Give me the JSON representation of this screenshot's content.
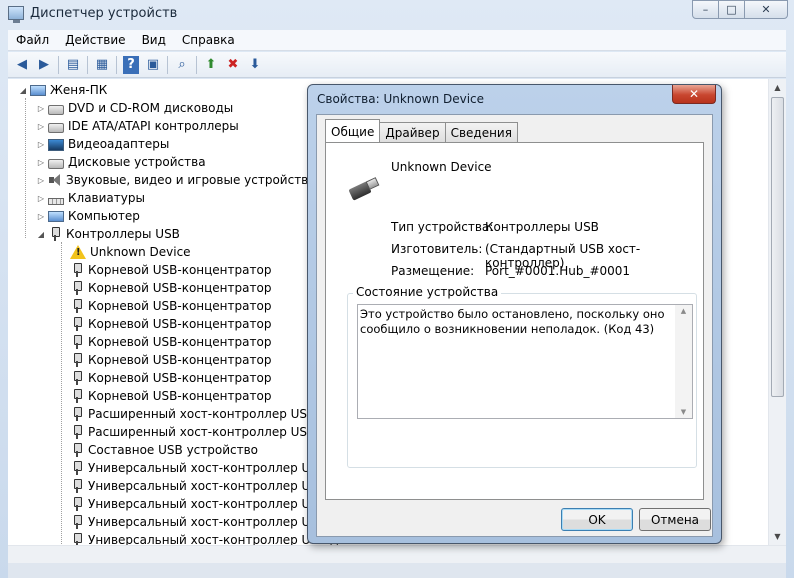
{
  "window": {
    "title": "Диспетчер устройств",
    "controls": {
      "minimize": "–",
      "maximize": "□",
      "close": "✕"
    }
  },
  "menu": [
    "Файл",
    "Действие",
    "Вид",
    "Справка"
  ],
  "toolbar": {
    "icons": [
      "back-icon",
      "forward-icon",
      "tree-view-icon",
      "properties-icon",
      "help-icon",
      "show-hidden-icon",
      "scan-hardware-icon",
      "update-driver-icon",
      "uninstall-icon",
      "disable-icon"
    ]
  },
  "tree": {
    "root": "Женя-ПК",
    "categories": [
      {
        "label": "DVD и CD-ROM дисководы",
        "icon": "disk-icon"
      },
      {
        "label": "IDE ATA/ATAPI контроллеры",
        "icon": "disk-icon"
      },
      {
        "label": "Видеоадаптеры",
        "icon": "video-icon"
      },
      {
        "label": "Дисковые устройства",
        "icon": "disk-icon"
      },
      {
        "label": "Звуковые, видео и игровые устройства",
        "icon": "sound-icon"
      },
      {
        "label": "Клавиатуры",
        "icon": "keyboard-icon"
      },
      {
        "label": "Компьютер",
        "icon": "computer-icon"
      },
      {
        "label": "Контроллеры USB",
        "icon": "usb-icon"
      }
    ],
    "usb_children": [
      {
        "label": "Unknown Device",
        "icon": "warning-icon"
      },
      {
        "label": "Корневой USB-концентратор",
        "icon": "usb-icon"
      },
      {
        "label": "Корневой USB-концентратор",
        "icon": "usb-icon"
      },
      {
        "label": "Корневой USB-концентратор",
        "icon": "usb-icon"
      },
      {
        "label": "Корневой USB-концентратор",
        "icon": "usb-icon"
      },
      {
        "label": "Корневой USB-концентратор",
        "icon": "usb-icon"
      },
      {
        "label": "Корневой USB-концентратор",
        "icon": "usb-icon"
      },
      {
        "label": "Корневой USB-концентратор",
        "icon": "usb-icon"
      },
      {
        "label": "Корневой USB-концентратор",
        "icon": "usb-icon"
      },
      {
        "label": "Расширенный хост-контроллер USB дл",
        "icon": "usb-icon"
      },
      {
        "label": "Расширенный хост-контроллер USB дл",
        "icon": "usb-icon"
      },
      {
        "label": "Составное USB устройство",
        "icon": "usb-icon"
      },
      {
        "label": "Универсальный хост-контроллер USB дл",
        "icon": "usb-icon"
      },
      {
        "label": "Универсальный хост-контроллер USB дл",
        "icon": "usb-icon"
      },
      {
        "label": "Универсальный хост-контроллер USB дл",
        "icon": "usb-icon"
      },
      {
        "label": "Универсальный хост-контроллер USB дл",
        "icon": "usb-icon"
      },
      {
        "label": "Универсальный хост-контроллер USB дл",
        "icon": "usb-icon"
      }
    ]
  },
  "dialog": {
    "title": "Свойства: Unknown Device",
    "close": "✕",
    "tabs": [
      "Общие",
      "Драйвер",
      "Сведения"
    ],
    "device_name": "Unknown Device",
    "props": [
      {
        "label": "Тип устройства:",
        "value": "Контроллеры USB"
      },
      {
        "label": "Изготовитель:",
        "value": "(Стандартный USB хост-контроллер)"
      },
      {
        "label": "Размещение:",
        "value": "Port_#0001.Hub_#0001"
      }
    ],
    "status_group_label": "Состояние устройства",
    "status_text": "Это устройство было остановлено, поскольку оно сообщило о возникновении неполадок. (Код 43)",
    "ok_label": "OK",
    "cancel_label": "Отмена"
  }
}
